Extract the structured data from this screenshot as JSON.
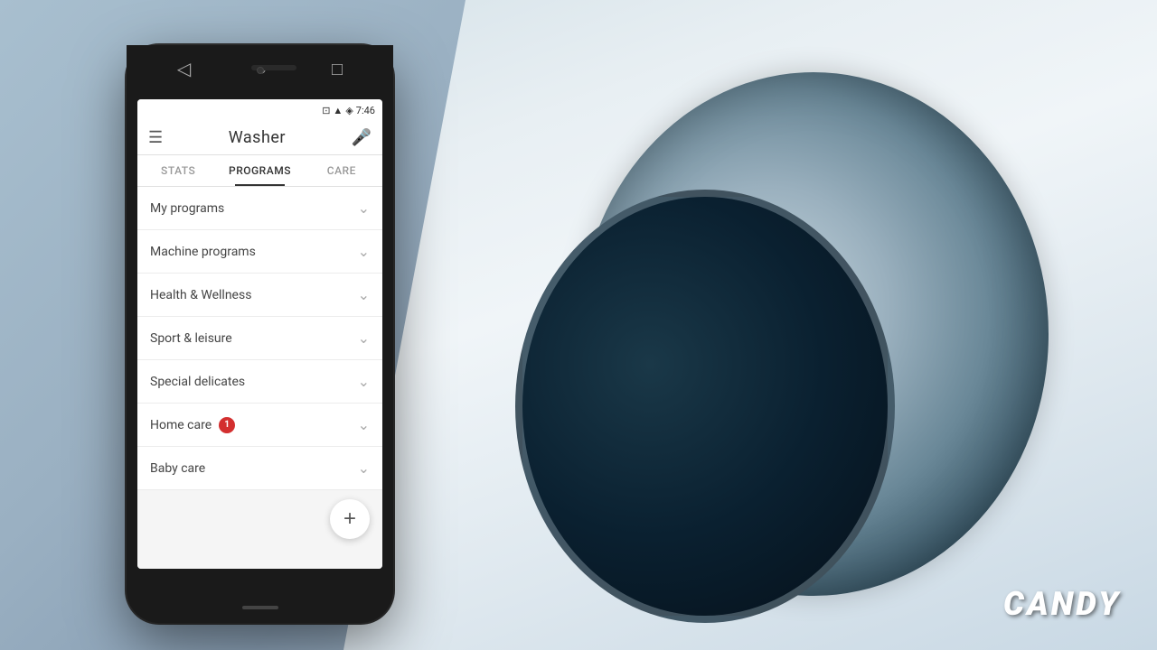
{
  "background": {
    "color": "#b0c4d4"
  },
  "brand": {
    "name": "CANDY",
    "color": "#ffffff"
  },
  "phone": {
    "status_bar": {
      "time": "7:46",
      "icons": [
        "battery",
        "signal",
        "wifi"
      ]
    },
    "header": {
      "menu_icon": "☰",
      "title": "Washer",
      "mic_icon": "🎤"
    },
    "tabs": [
      {
        "label": "STATS",
        "active": false
      },
      {
        "label": "PROGRAMS",
        "active": true
      },
      {
        "label": "CARE",
        "active": false
      }
    ],
    "menu_items": [
      {
        "label": "My programs",
        "badge": null
      },
      {
        "label": "Machine programs",
        "badge": null
      },
      {
        "label": "Health & Wellness",
        "badge": null
      },
      {
        "label": "Sport & leisure",
        "badge": null
      },
      {
        "label": "Special delicates",
        "badge": null
      },
      {
        "label": "Home care",
        "badge": "1"
      },
      {
        "label": "Baby care",
        "badge": null
      }
    ],
    "fab": {
      "icon": "+",
      "label": "Add program"
    },
    "nav_bar": {
      "back_icon": "◁",
      "home_icon": "○",
      "recents_icon": "□"
    }
  }
}
